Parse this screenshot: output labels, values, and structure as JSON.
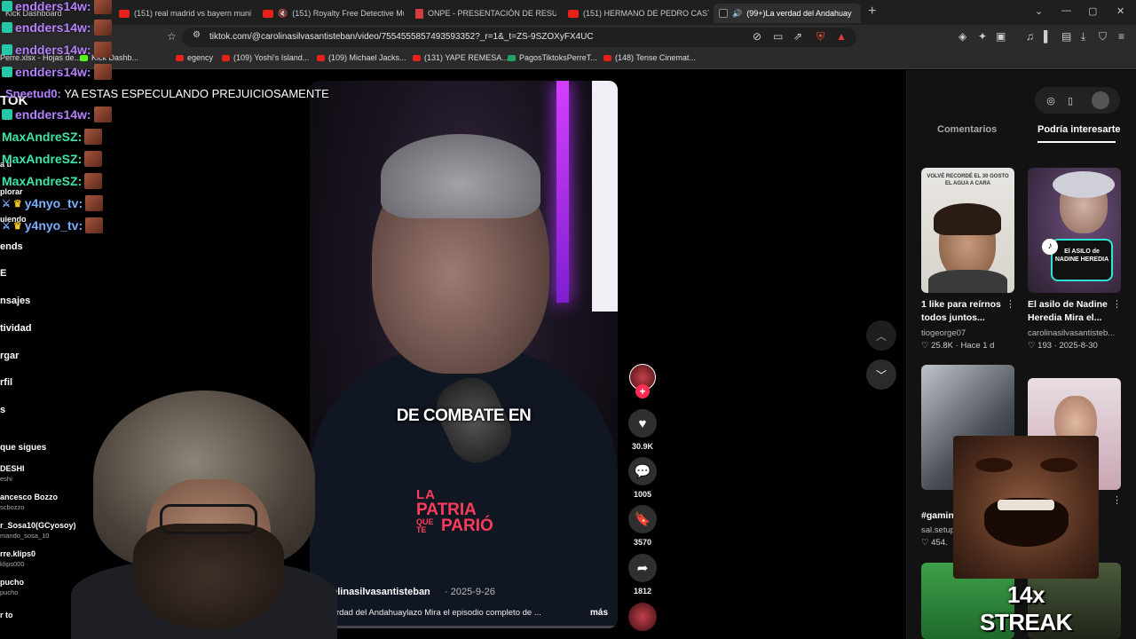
{
  "browser": {
    "tabs": [
      {
        "label": "Kick Dashboard"
      },
      {
        "label": "(151) real madrid vs bayern munich -"
      },
      {
        "label": "(151) Royalty Free Detective Musi"
      },
      {
        "label": "ONPE - PRESENTACIÓN DE RESULTA"
      },
      {
        "label": "(151) HERMANO DE PEDRO CASTILLO"
      },
      {
        "label": "(99+)La verdad del Andahuay"
      }
    ],
    "url": "tiktok.com/@carolinasilvasantisteban/video/7554555857493593352?_r=1&_t=ZS-9SZOXyFX4UC",
    "bookmarks": [
      {
        "label": "Perre.xlsx - Hojas de..."
      },
      {
        "label": "Kick Dashb..."
      },
      {
        "label": "egency"
      },
      {
        "label": "(109) Yoshi's Island..."
      },
      {
        "label": "(109) Michael Jacks..."
      },
      {
        "label": "(131) YAPE REMESA..."
      },
      {
        "label": "PagosTiktoksPerreT..."
      },
      {
        "label": "(148) Tense Cinemat..."
      }
    ]
  },
  "chat": {
    "lines": [
      {
        "user": "endders14w:"
      },
      {
        "user": "endders14w:"
      },
      {
        "user": "endders14w:"
      },
      {
        "user": "endders14w:"
      },
      {
        "user": "endders14w:"
      },
      {
        "user": "MaxAndreSZ:"
      },
      {
        "user": "MaxAndreSZ:"
      },
      {
        "user": "MaxAndreSZ:"
      },
      {
        "user": "y4nyo_tv:"
      },
      {
        "user": "y4nyo_tv:"
      }
    ],
    "message_user": "Sneetud0:",
    "message_text": "YA ESTAS ESPECULANDO PREJUICIOSAMENTE"
  },
  "left_sidebar": {
    "items": [
      "TOK",
      "a ti",
      "plorar",
      "uiendo",
      "ends",
      "E",
      "nsajes",
      "tividad",
      "rgar",
      "rfil",
      "s"
    ],
    "following_title": "que sigues",
    "following": [
      {
        "name": "DESHI",
        "sub": "eshi"
      },
      {
        "name": "ancesco Bozzo",
        "sub": "scbozzo"
      },
      {
        "name": "r_Sosa10(GCyosoy)",
        "sub": "mando_sosa_10"
      },
      {
        "name": "rre.klips0",
        "sub": "klips000"
      },
      {
        "name": "pucho",
        "sub": "pucho"
      },
      {
        "name": "r to",
        "sub": ""
      }
    ]
  },
  "video": {
    "caption": "DE COMBATE EN",
    "logo_la": "LA",
    "logo_patria": "PATRIA",
    "logo_que": "QUE",
    "logo_te": "TE",
    "logo_pario": "PARIÓ",
    "author": "carolinasilvasantisteban",
    "date": "· 2025-9-26",
    "description": "a verdad del Andahuaylazo Mira el episodio completo de ...",
    "more": "más"
  },
  "actions": {
    "likes": "30.9K",
    "comments": "1005",
    "saves": "3570",
    "shares": "1812"
  },
  "right_panel": {
    "tab_comments": "Comentarios",
    "tab_suggested": "Podría interesarte",
    "videos": [
      {
        "title": "1 like para reírnos todos juntos...",
        "author": "tiogeorge07",
        "likes": "25.8K",
        "time": "· Hace 1 d",
        "thumb_text": "VOLVÉ RECORDÉ EL 30 GOSTO EL AGUA A CARA"
      },
      {
        "title": "El asilo de Nadine Heredia Mira el...",
        "author": "carolinasilvasantisteb...",
        "likes": "193",
        "time": "· 2025-8-30",
        "thumb_text": "El ASILO de NADINE HEREDIA"
      },
      {
        "title": "#gamin",
        "author": "sal.setup",
        "likes": "454.",
        "time": ""
      },
      {
        "title": "",
        "author": "",
        "likes": "",
        "time": ""
      }
    ]
  },
  "overlay": {
    "streak": "14x STREAK"
  }
}
